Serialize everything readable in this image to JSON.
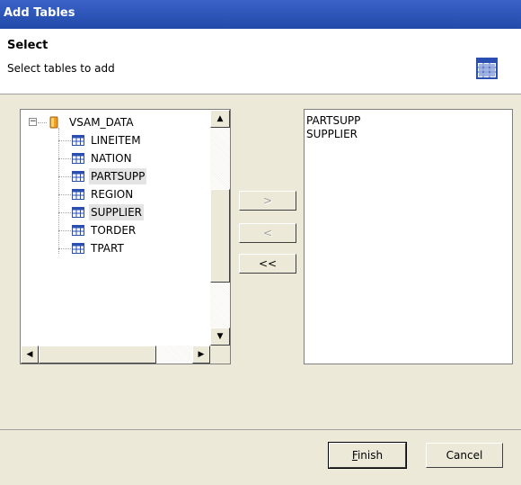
{
  "window": {
    "title": "Add Tables"
  },
  "header": {
    "heading": "Select",
    "description": "Select tables to add",
    "icon": "table-grid-icon"
  },
  "tree": {
    "root": {
      "label": "VSAM_DATA",
      "icon": "database-icon",
      "expander": "−"
    },
    "items": [
      {
        "label": "LINEITEM",
        "icon": "table-icon",
        "selected": false
      },
      {
        "label": "NATION",
        "icon": "table-icon",
        "selected": false
      },
      {
        "label": "PARTSUPP",
        "icon": "table-icon",
        "selected": true
      },
      {
        "label": "REGION",
        "icon": "table-icon",
        "selected": false
      },
      {
        "label": "SUPPLIER",
        "icon": "table-icon",
        "selected": true
      },
      {
        "label": "TORDER",
        "icon": "table-icon",
        "selected": false
      },
      {
        "label": "TPART",
        "icon": "table-icon",
        "selected": false
      }
    ]
  },
  "buttons_mid": {
    "add": ">",
    "remove": "<",
    "remove_all": "<<"
  },
  "selected_list": [
    "PARTSUPP",
    "SUPPLIER"
  ],
  "footer": {
    "finish_first": "F",
    "finish_rest": "inish",
    "cancel": "Cancel"
  },
  "colors": {
    "title_bar": "#224aa9",
    "dialog_bg": "#ece9d8",
    "table_icon": "#2a4fb0",
    "db_icon": "#f0a020"
  }
}
